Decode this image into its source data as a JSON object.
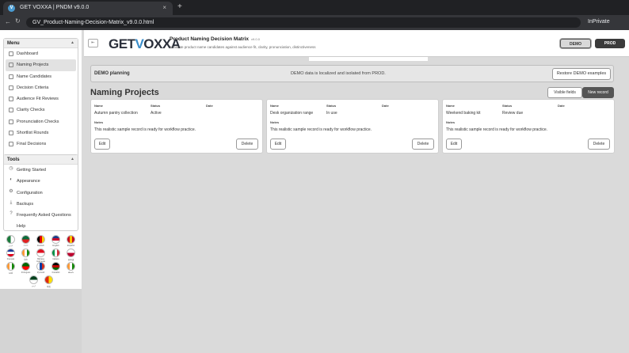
{
  "browser": {
    "tab_title": "GET VOXXA | PNDM v9.0.0",
    "tab_favicon": "V",
    "close_glyph": "×",
    "new_tab_glyph": "+",
    "back_glyph": "←",
    "reload_glyph": "↻",
    "url": "GV_Product-Naming-Decision-Matrix_v9.0.0.html",
    "mode_label": "InPrivate"
  },
  "sidebar": {
    "menu_title": "Menu",
    "collapse_glyph": "▲",
    "menu_items": [
      {
        "label": "Dashboard",
        "icon": "dashboard-icon",
        "active": false
      },
      {
        "label": "Naming Projects",
        "icon": "folder-icon",
        "active": true
      },
      {
        "label": "Name Candidates",
        "icon": "list-icon",
        "active": false
      },
      {
        "label": "Decision Criteria",
        "icon": "criteria-icon",
        "active": false
      },
      {
        "label": "Audience Fit Reviews",
        "icon": "audience-icon",
        "active": false
      },
      {
        "label": "Clarity Checks",
        "icon": "check-icon",
        "active": false
      },
      {
        "label": "Pronunciation Checks",
        "icon": "speech-icon",
        "active": false
      },
      {
        "label": "Shortlist Rounds",
        "icon": "shortlist-icon",
        "active": false
      },
      {
        "label": "Final Decisions",
        "icon": "decision-icon",
        "active": false
      }
    ],
    "tools_title": "Tools",
    "tools_items": [
      {
        "label": "Getting Started",
        "icon": "rocket-icon",
        "glyph": "◷"
      },
      {
        "label": "Appearance",
        "icon": "palette-icon",
        "glyph": "◐"
      },
      {
        "label": "Configuration",
        "icon": "gear-icon",
        "glyph": "⚙"
      },
      {
        "label": "Backups",
        "icon": "backup-icon",
        "glyph": "⤓"
      },
      {
        "label": "Frequently Asked Questions",
        "icon": "faq-icon",
        "glyph": "?"
      },
      {
        "label": "Help",
        "icon": "help-icon",
        "glyph": ""
      }
    ],
    "languages": [
      {
        "label": "عربي",
        "colors": [
          "#1a7a3a",
          "#ffffff"
        ]
      },
      {
        "label": "বাংলা",
        "colors": [
          "#0b6b3a",
          "#e02020"
        ]
      },
      {
        "label": "Deutsch",
        "colors": [
          "#000000",
          "#dd0000",
          "#ffce00"
        ]
      },
      {
        "label": "English",
        "colors": [
          "#1a3a8a",
          "#c8102e",
          "#ffffff"
        ]
      },
      {
        "label": "Español",
        "colors": [
          "#c60b1e",
          "#ffc400",
          "#c60b1e"
        ]
      },
      {
        "label": "Français",
        "colors": [
          "#1a3a9a",
          "#ffffff",
          "#e1001a"
        ]
      },
      {
        "label": "हिंदी",
        "colors": [
          "#ff9933",
          "#ffffff",
          "#138808"
        ]
      },
      {
        "label": "Bahasa Indonesia",
        "colors": [
          "#e01020",
          "#ffffff"
        ]
      },
      {
        "label": "Italiano",
        "colors": [
          "#009246",
          "#ffffff",
          "#ce2b37"
        ]
      },
      {
        "label": "日本語",
        "colors": [
          "#ffffff",
          "#bc002d"
        ]
      },
      {
        "label": "मराठी",
        "colors": [
          "#ff9933",
          "#ffffff",
          "#138808"
        ]
      },
      {
        "label": "Português",
        "colors": [
          "#006600",
          "#ff0000"
        ]
      },
      {
        "label": "Русский",
        "colors": [
          "#ffffff",
          "#0039a6",
          "#d52b1e"
        ]
      },
      {
        "label": "Kiswahili",
        "colors": [
          "#000000",
          "#bb0000",
          "#006600"
        ]
      },
      {
        "label": "తెలుగు",
        "colors": [
          "#ff9933",
          "#ffffff",
          "#138808"
        ]
      },
      {
        "label": "اردو",
        "colors": [
          "#01411c",
          "#ffffff"
        ]
      },
      {
        "label": "中文",
        "colors": [
          "#de2910",
          "#ffde00"
        ]
      }
    ]
  },
  "header": {
    "logo_text_a": "GET",
    "logo_text_v": "V",
    "logo_text_b": "OXXA",
    "app_title": "Product Naming Decision Matrix",
    "app_version": "v9.0.0",
    "app_subtitle": "Evaluate product name candidates against audience fit, clarity, pronunciation, distinctiveness",
    "env_demo": "DEMO",
    "env_prod": "PROD",
    "toggle_glyph": "⇤"
  },
  "banner": {
    "label": "DEMO planning",
    "message": "DEMO data is localized and isolated from PROD.",
    "restore_button": "Restore DEMO examples"
  },
  "page": {
    "title": "Naming Projects",
    "visible_fields_button": "Visible fields",
    "new_record_button": "New record"
  },
  "card_labels": {
    "name": "Name",
    "status": "Status",
    "date": "Date",
    "notes": "Notes",
    "edit": "Edit",
    "delete": "Delete"
  },
  "records": [
    {
      "name": "Autumn pantry collection",
      "status": "Active",
      "date": "",
      "notes": "This realistic sample record is ready for workflow practice."
    },
    {
      "name": "Desk organization range",
      "status": "In use",
      "date": "",
      "notes": "This realistic sample record is ready for workflow practice."
    },
    {
      "name": "Weekend baking kit",
      "status": "Review due",
      "date": "",
      "notes": "This realistic sample record is ready for workflow practice."
    }
  ]
}
